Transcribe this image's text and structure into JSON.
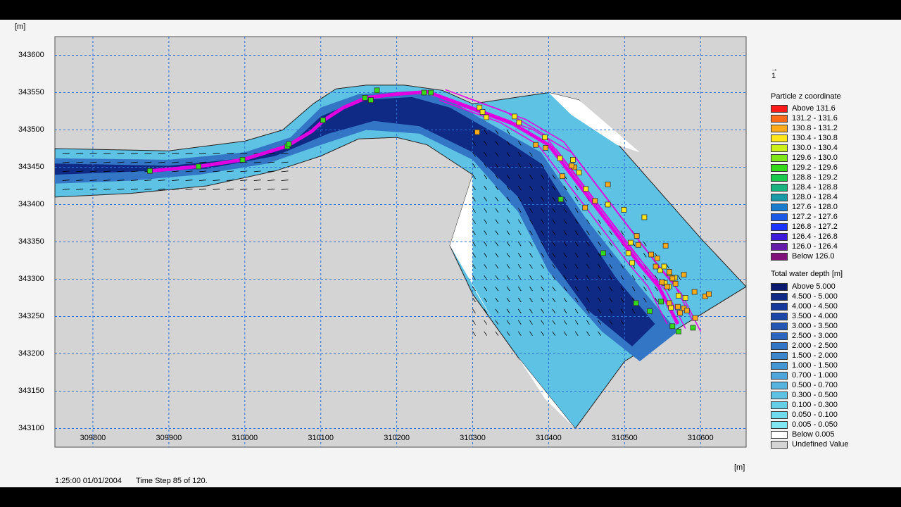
{
  "units": {
    "y_unit": "[m]",
    "x_unit": "[m]"
  },
  "vector_scale_label": "1",
  "status": {
    "time": "1:25:00 01/01/2004",
    "step": "Time Step 85 of 120."
  },
  "chart_data": {
    "type": "scatter",
    "xlim": [
      309750,
      310660
    ],
    "ylim": [
      343075,
      343625
    ],
    "x_ticks": [
      "309800",
      "309900",
      "310000",
      "310100",
      "310200",
      "310300",
      "310400",
      "310500",
      "310600"
    ],
    "y_ticks": [
      "343600",
      "343550",
      "343500",
      "343450",
      "343400",
      "343350",
      "343300",
      "343250",
      "343200",
      "343150",
      "343100"
    ],
    "grid": true,
    "colors": {
      "plot_bg": "#d4d4d4",
      "particle_track": "#e000e0",
      "grid": "#2a6fd6"
    },
    "channel_outline": [
      [
        309750,
        343475
      ],
      [
        309900,
        343472
      ],
      [
        310000,
        343485
      ],
      [
        310050,
        343500
      ],
      [
        310090,
        343535
      ],
      [
        310120,
        343555
      ],
      [
        310160,
        343560
      ],
      [
        310210,
        343560
      ],
      [
        310260,
        343553
      ],
      [
        310300,
        343535
      ],
      [
        310400,
        343550
      ],
      [
        310440,
        343540
      ],
      [
        310600,
        343355
      ],
      [
        310660,
        343290
      ],
      [
        310500,
        343190
      ],
      [
        310435,
        343100
      ],
      [
        310360,
        343195
      ],
      [
        310300,
        343280
      ],
      [
        310270,
        343345
      ],
      [
        310300,
        343440
      ],
      [
        310240,
        343480
      ],
      [
        310200,
        343490
      ],
      [
        310150,
        343488
      ],
      [
        310100,
        343465
      ],
      [
        310040,
        343445
      ],
      [
        309950,
        343425
      ],
      [
        309850,
        343415
      ],
      [
        309750,
        343410
      ]
    ],
    "dry_areas": [
      [
        [
          310400,
          343550
        ],
        [
          310440,
          343540
        ],
        [
          310520,
          343470
        ],
        [
          310490,
          343480
        ],
        [
          310430,
          343520
        ]
      ],
      [
        [
          310300,
          343440
        ],
        [
          310270,
          343345
        ],
        [
          310330,
          343240
        ],
        [
          310300,
          343290
        ]
      ],
      [
        [
          310360,
          343195
        ],
        [
          310435,
          343100
        ],
        [
          310395,
          343140
        ]
      ]
    ],
    "particle_track": [
      [
        309875,
        343445
      ],
      [
        309940,
        343451
      ],
      [
        309997,
        343460
      ],
      [
        310055,
        343478
      ],
      [
        310088,
        343498
      ],
      [
        310104,
        343513
      ],
      [
        310130,
        343530
      ],
      [
        310160,
        343543
      ],
      [
        310200,
        343548
      ],
      [
        310240,
        343551
      ],
      [
        310270,
        343540
      ],
      [
        310310,
        343525
      ],
      [
        310350,
        343510
      ],
      [
        310400,
        343480
      ],
      [
        310430,
        343440
      ],
      [
        310460,
        343400
      ],
      [
        310490,
        343360
      ],
      [
        310520,
        343320
      ],
      [
        310545,
        343290
      ],
      [
        310560,
        343260
      ],
      [
        310570,
        343240
      ]
    ],
    "particles_green": [
      [
        309875,
        343445
      ],
      [
        309939,
        343451
      ],
      [
        309997,
        343460
      ],
      [
        310056,
        343478
      ],
      [
        310058,
        343481
      ],
      [
        310103,
        343513
      ],
      [
        310158,
        343543
      ],
      [
        310166,
        343540
      ],
      [
        310174,
        343553
      ],
      [
        310236,
        343550
      ],
      [
        310245,
        343550
      ],
      [
        310472,
        343335
      ],
      [
        310416,
        343407
      ],
      [
        310533,
        343257
      ],
      [
        310548,
        343270
      ],
      [
        310563,
        343237
      ],
      [
        310571,
        343230
      ],
      [
        310590,
        343235
      ],
      [
        310515,
        343268
      ]
    ],
    "particles_yellow": [
      [
        310309,
        343530
      ],
      [
        310313,
        343524
      ],
      [
        310318,
        343517
      ],
      [
        310355,
        343518
      ],
      [
        310361,
        343510
      ],
      [
        310395,
        343490
      ],
      [
        310415,
        343462
      ],
      [
        310432,
        343460
      ],
      [
        310440,
        343443
      ],
      [
        310449,
        343421
      ],
      [
        310478,
        343400
      ],
      [
        310499,
        343393
      ],
      [
        310508,
        343349
      ],
      [
        310505,
        343335
      ],
      [
        310510,
        343322
      ],
      [
        310526,
        343383
      ],
      [
        310547,
        343312
      ],
      [
        310552,
        343317
      ],
      [
        310559,
        343308
      ],
      [
        310566,
        343302
      ],
      [
        310553,
        343295
      ],
      [
        310558,
        343290
      ],
      [
        310561,
        343262
      ],
      [
        310571,
        343278
      ],
      [
        310580,
        343275
      ]
    ],
    "particles_orange": [
      [
        310306,
        343497
      ],
      [
        310383,
        343480
      ],
      [
        310396,
        343476
      ],
      [
        310418,
        343438
      ],
      [
        310434,
        343450
      ],
      [
        310430,
        343452
      ],
      [
        310448,
        343396
      ],
      [
        310461,
        343405
      ],
      [
        310478,
        343427
      ],
      [
        310541,
        343317
      ],
      [
        310516,
        343358
      ],
      [
        310518,
        343346
      ],
      [
        310535,
        343333
      ],
      [
        310543,
        343328
      ],
      [
        310554,
        343345
      ],
      [
        310559,
        343310
      ],
      [
        310563,
        343301
      ],
      [
        310567,
        343294
      ],
      [
        310578,
        343306
      ],
      [
        310549,
        343296
      ],
      [
        310556,
        343290
      ],
      [
        310570,
        343263
      ],
      [
        310578,
        343261
      ],
      [
        310582,
        343258
      ],
      [
        310593,
        343248
      ],
      [
        310606,
        343277
      ],
      [
        310611,
        343280
      ],
      [
        310592,
        343283
      ],
      [
        310559,
        343268
      ],
      [
        310573,
        343255
      ]
    ],
    "legend_particle": {
      "title": "Particle z coordinate",
      "items": [
        {
          "label": "Above  131.6",
          "color": "#ff1a1a"
        },
        {
          "label": "131.2 - 131.6",
          "color": "#ff6a1a"
        },
        {
          "label": "130.8 - 131.2",
          "color": "#ffaa1a"
        },
        {
          "label": "130.4 - 130.8",
          "color": "#ffe61a"
        },
        {
          "label": "130.0 - 130.4",
          "color": "#ccee1a"
        },
        {
          "label": "129.6 - 130.0",
          "color": "#7fe61a"
        },
        {
          "label": "129.2 - 129.6",
          "color": "#33d91a"
        },
        {
          "label": "128.8 - 129.2",
          "color": "#1ac94d"
        },
        {
          "label": "128.4 - 128.8",
          "color": "#1ab380"
        },
        {
          "label": "128.0 - 128.4",
          "color": "#1a99a6"
        },
        {
          "label": "127.6 - 128.0",
          "color": "#1a7acc"
        },
        {
          "label": "127.2 - 127.6",
          "color": "#1a59e6"
        },
        {
          "label": "126.8 - 127.2",
          "color": "#1a33ff"
        },
        {
          "label": "126.4 - 126.8",
          "color": "#3d1ad9"
        },
        {
          "label": "126.0 - 126.4",
          "color": "#661aaa"
        },
        {
          "label": "Below  126.0",
          "color": "#80107a"
        }
      ]
    },
    "legend_depth": {
      "title": "Total water depth [m]",
      "items": [
        {
          "label": "Above  5.000",
          "color": "#0a1a6e"
        },
        {
          "label": "4.500 - 5.000",
          "color": "#0f2a85"
        },
        {
          "label": "4.000 - 4.500",
          "color": "#16389a"
        },
        {
          "label": "3.500 - 4.000",
          "color": "#1c46a8"
        },
        {
          "label": "3.000 - 3.500",
          "color": "#2456b4"
        },
        {
          "label": "2.500 - 3.000",
          "color": "#2c66be"
        },
        {
          "label": "2.000 - 2.500",
          "color": "#3476c6"
        },
        {
          "label": "1.500 - 2.000",
          "color": "#3c86cd"
        },
        {
          "label": "1.000 - 1.500",
          "color": "#4596d4"
        },
        {
          "label": "0.700 - 1.000",
          "color": "#4ea6da"
        },
        {
          "label": "0.500 - 0.700",
          "color": "#56b4df"
        },
        {
          "label": "0.300 - 0.500",
          "color": "#5ec2e4"
        },
        {
          "label": "0.100 - 0.300",
          "color": "#66cfe8"
        },
        {
          "label": "0.050 - 0.100",
          "color": "#70dbed"
        },
        {
          "label": "0.005 - 0.050",
          "color": "#7fe6f2"
        },
        {
          "label": "Below  0.005",
          "color": "#ffffff"
        },
        {
          "label": "Undefined Value",
          "color": "#d4d4d4"
        }
      ]
    }
  }
}
